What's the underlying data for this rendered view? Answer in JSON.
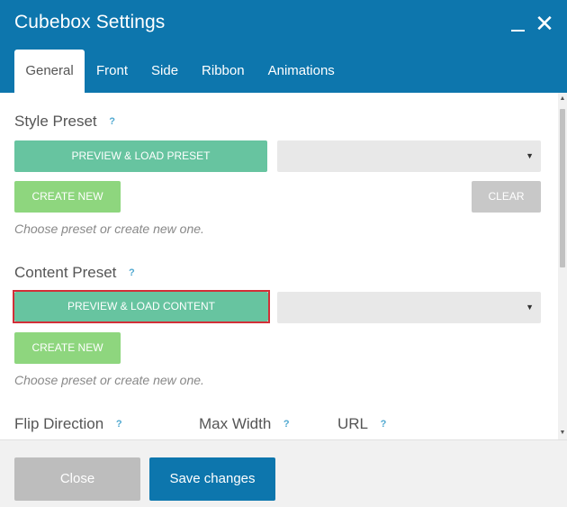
{
  "window": {
    "title": "Cubebox Settings",
    "minimize_icon": "minimize-icon",
    "close_icon": "close-icon",
    "close_glyph": "✕"
  },
  "tabs": [
    {
      "label": "General",
      "active": true
    },
    {
      "label": "Front",
      "active": false
    },
    {
      "label": "Side",
      "active": false
    },
    {
      "label": "Ribbon",
      "active": false
    },
    {
      "label": "Animations",
      "active": false
    }
  ],
  "style_preset": {
    "title": "Style Preset",
    "help": "?",
    "preview_label": "PREVIEW & LOAD PRESET",
    "select_value": "",
    "select_arrow": "▼",
    "create_label": "CREATE NEW",
    "clear_label": "CLEAR",
    "hint": "Choose preset or create new one."
  },
  "content_preset": {
    "title": "Content Preset",
    "help": "?",
    "preview_label": "PREVIEW & LOAD CONTENT",
    "select_value": "",
    "select_arrow": "▼",
    "create_label": "CREATE NEW",
    "hint": "Choose preset or create new one."
  },
  "fields": {
    "flip_direction": {
      "label": "Flip Direction",
      "help": "?"
    },
    "max_width": {
      "label": "Max Width",
      "help": "?"
    },
    "url": {
      "label": "URL",
      "help": "?"
    }
  },
  "scrollbar": {
    "up_arrow": "▲",
    "down_arrow": "▼"
  },
  "footer": {
    "close_label": "Close",
    "save_label": "Save changes"
  },
  "colors": {
    "header": "#0d76ad",
    "preview_button": "#67c4a0",
    "create_button": "#8ed67e",
    "highlight": "#d22f38"
  }
}
